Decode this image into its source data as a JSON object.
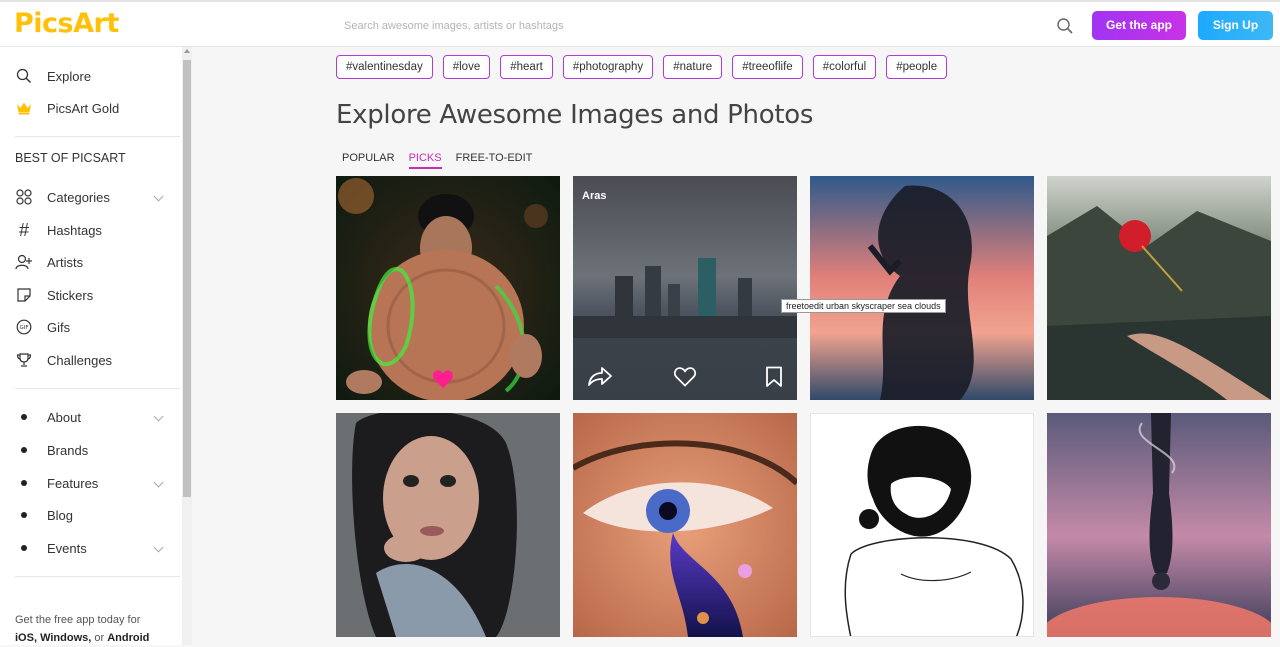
{
  "brand": {
    "logo": "PicsArt",
    "accent": "#ffc107"
  },
  "search": {
    "placeholder": "Search awesome images, artists or hashtags"
  },
  "header": {
    "get_app": "Get the app",
    "sign_up": "Sign Up"
  },
  "sidebar": {
    "top": [
      {
        "label": "Explore",
        "icon": "search-icon"
      },
      {
        "label": "PicsArt Gold",
        "icon": "crown-icon"
      }
    ],
    "section_title": "BEST OF PICSART",
    "best": [
      {
        "label": "Categories",
        "icon": "grid-icon",
        "expandable": true
      },
      {
        "label": "Hashtags",
        "icon": "hash-icon"
      },
      {
        "label": "Artists",
        "icon": "add-user-icon"
      },
      {
        "label": "Stickers",
        "icon": "sticker-icon"
      },
      {
        "label": "Gifs",
        "icon": "gif-icon"
      },
      {
        "label": "Challenges",
        "icon": "trophy-icon"
      }
    ],
    "more": [
      {
        "label": "About",
        "expandable": true
      },
      {
        "label": "Brands"
      },
      {
        "label": "Features",
        "expandable": true
      },
      {
        "label": "Blog"
      },
      {
        "label": "Events",
        "expandable": true
      }
    ],
    "footer_line1": "Get the free app today for",
    "footer_ios": "iOS,",
    "footer_windows": "Windows,",
    "footer_or": "or",
    "footer_android": "Android"
  },
  "tags": [
    "#valentinesday",
    "#love",
    "#heart",
    "#photography",
    "#nature",
    "#treeoflife",
    "#colorful",
    "#people"
  ],
  "main": {
    "title": "Explore Awesome Images and Photos",
    "tabs": [
      {
        "label": "POPULAR",
        "active": false
      },
      {
        "label": "PICKS",
        "active": true
      },
      {
        "label": "FREE-TO-EDIT",
        "active": false
      }
    ]
  },
  "cards": {
    "hovered_author": "Aras",
    "tooltip": "freetoedit urban skyscraper sea clouds"
  }
}
